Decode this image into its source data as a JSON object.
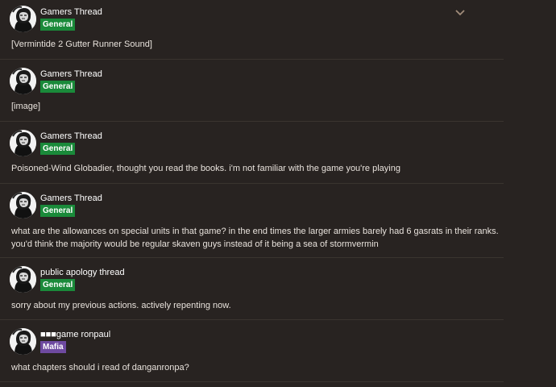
{
  "colors": {
    "background": "#282321",
    "divider": "#3a342f",
    "general_badge": "#1a8a3a",
    "mafia_badge": "#6e4aa0",
    "chevron": "#a18c7a"
  },
  "header": {
    "collapse_icon": "chevron-down-icon"
  },
  "posts": [
    {
      "topic": "Gamers Thread",
      "category": "General",
      "body": "[Vermintide 2 Gutter Runner Sound]"
    },
    {
      "topic": "Gamers Thread",
      "category": "General",
      "body": "[image]"
    },
    {
      "topic": "Gamers Thread",
      "category": "General",
      "body": "Poisoned-Wind Globadier, thought you read the books. i'm not familiar with the game you're playing"
    },
    {
      "topic": "Gamers Thread",
      "category": "General",
      "body": "what are the allowances on special units in that game? in the end times the larger armies barely had 6 gasrats in their ranks. you'd think the majority would be regular skaven guys instead of it being a sea of stormvermin"
    },
    {
      "topic": "public apology thread",
      "category": "General",
      "body": "sorry about my previous actions. actively repenting now."
    },
    {
      "topic": "■■■game ronpaul",
      "category": "Mafia",
      "body": "what chapters should i read of danganronpa?"
    }
  ]
}
